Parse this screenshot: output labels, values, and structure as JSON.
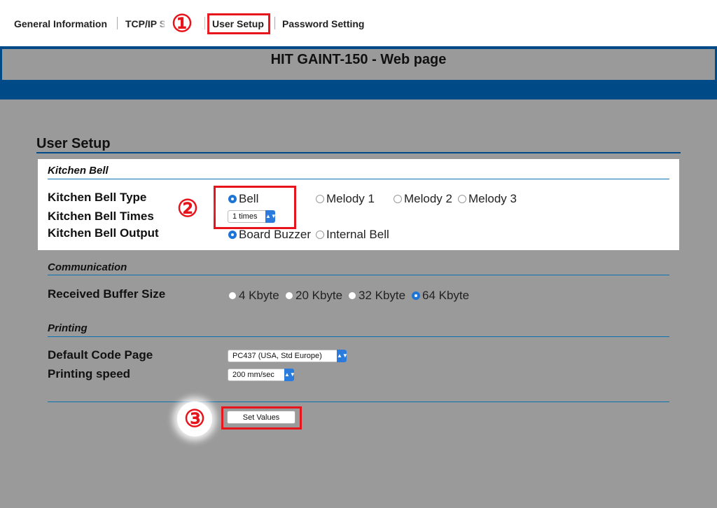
{
  "nav": {
    "tabs": [
      "General Information",
      "TCP/IP S",
      "User Setup",
      "Password Setting"
    ]
  },
  "header": {
    "title": "HIT GAINT-150 - Web page"
  },
  "page": {
    "title": "User Setup"
  },
  "kitchen": {
    "section": "Kitchen Bell",
    "type_label": "Kitchen Bell Type",
    "times_label": "Kitchen Bell Times",
    "output_label": "Kitchen Bell Output",
    "type_options": [
      "Bell",
      "Melody 1",
      "Melody 2",
      "Melody 3"
    ],
    "type_selected": "Bell",
    "times_value": "1 times",
    "output_options": [
      "Board Buzzer",
      "Internal Bell"
    ],
    "output_selected": "Board Buzzer"
  },
  "comm": {
    "section": "Communication",
    "buffer_label": "Received Buffer Size",
    "buffer_options": [
      "4 Kbyte",
      "20 Kbyte",
      "32 Kbyte",
      "64 Kbyte"
    ],
    "buffer_selected": "64 Kbyte"
  },
  "printing": {
    "section": "Printing",
    "code_label": "Default Code Page",
    "code_value": "PC437 (USA, Std Europe)",
    "speed_label": "Printing speed",
    "speed_value": "200 mm/sec"
  },
  "actions": {
    "set_values": "Set Values"
  },
  "annotations": [
    "①",
    "②",
    "③"
  ],
  "colors": {
    "accent": "#004b87",
    "highlight": "#e8141b",
    "radio": "#1d75d6"
  }
}
